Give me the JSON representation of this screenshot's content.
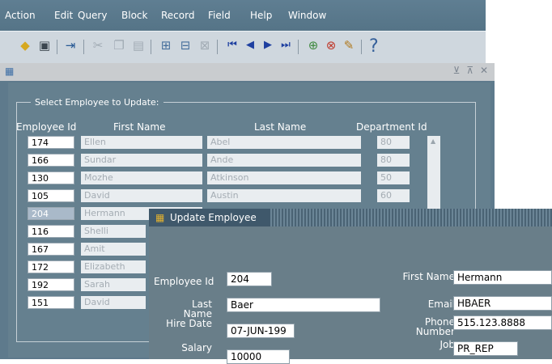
{
  "menu": [
    "Action",
    "Edit",
    "Query",
    "Block",
    "Record",
    "Field",
    "Help",
    "Window"
  ],
  "toolbar": {
    "icons": [
      "save-icon",
      "print-icon",
      "exit-icon",
      "cut-icon",
      "copy-icon",
      "paste-icon",
      "enter-query-icon",
      "execute-query-icon",
      "cancel-query-icon",
      "first-record-icon",
      "previous-record-icon",
      "next-record-icon",
      "last-record-icon",
      "insert-record-icon",
      "delete-record-icon",
      "lock-record-icon",
      "help-icon"
    ],
    "help_glyph": "?"
  },
  "mdi": {
    "controls": "⊻ ⊼ ✕"
  },
  "select_form": {
    "group_label": "Select Employee to Update:",
    "headers": {
      "employee_id": "Employee Id",
      "first_name": "First Name",
      "last_name": "Last Name",
      "department_id": "Department Id"
    },
    "rows": [
      {
        "employee_id": "174",
        "first_name": "Ellen",
        "last_name": "Abel",
        "department_id": "80"
      },
      {
        "employee_id": "166",
        "first_name": "Sundar",
        "last_name": "Ande",
        "department_id": "80"
      },
      {
        "employee_id": "130",
        "first_name": "Mozhe",
        "last_name": "Atkinson",
        "department_id": "50"
      },
      {
        "employee_id": "105",
        "first_name": "David",
        "last_name": "Austin",
        "department_id": "60"
      },
      {
        "employee_id": "204",
        "first_name": "Hermann",
        "last_name": "",
        "department_id": ""
      },
      {
        "employee_id": "116",
        "first_name": "Shelli",
        "last_name": "",
        "department_id": ""
      },
      {
        "employee_id": "167",
        "first_name": "Amit",
        "last_name": "",
        "department_id": ""
      },
      {
        "employee_id": "172",
        "first_name": "Elizabeth",
        "last_name": "",
        "department_id": ""
      },
      {
        "employee_id": "192",
        "first_name": "Sarah",
        "last_name": "",
        "department_id": ""
      },
      {
        "employee_id": "151",
        "first_name": "David",
        "last_name": "",
        "department_id": ""
      }
    ],
    "selected_row": 4
  },
  "dialog": {
    "title": "Update Employee",
    "labels": {
      "employee_id": "Employee Id",
      "last_name": "Last Name",
      "hire_date": "Hire Date",
      "salary": "Salary",
      "first_name": "First Name",
      "email": "Email",
      "phone": "Phone Number",
      "job": "Job"
    },
    "values": {
      "employee_id": "204",
      "last_name": "Baer",
      "hire_date": "07-JUN-199",
      "salary": "10000",
      "first_name": "Hermann",
      "email": "HBAER",
      "phone": "515.123.8888",
      "job": "PR_REP"
    }
  },
  "colors": {
    "menubar": "#5f7e92",
    "toolbar": "#cfd7de",
    "canvas": "#5e7a8c",
    "dialog": "#697e89",
    "selected_cell": "#a9b9c9"
  }
}
